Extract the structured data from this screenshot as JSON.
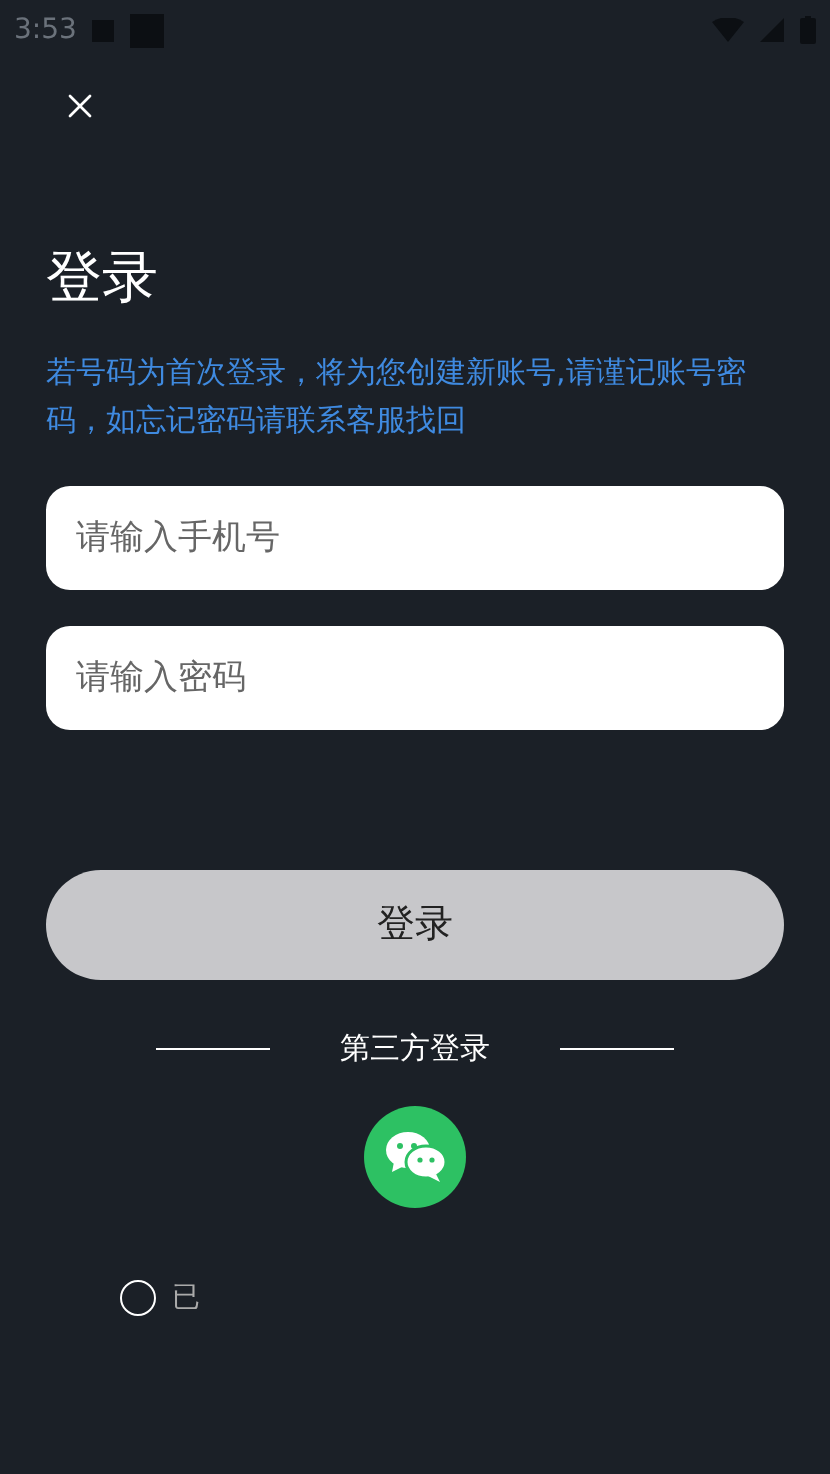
{
  "status_bar": {
    "time": "3:53"
  },
  "title": "登录",
  "notice": "若号码为首次登录，将为您创建新账号,请谨记账号密码，如忘记密码请联系客服找回",
  "phone_field": {
    "placeholder": "请输入手机号"
  },
  "password_field": {
    "placeholder": "请输入密码"
  },
  "login_button": {
    "label": "登录",
    "disabled": true
  },
  "third_party": {
    "label": "第三方登录"
  },
  "agreement": {
    "checked": false,
    "text": "已"
  }
}
